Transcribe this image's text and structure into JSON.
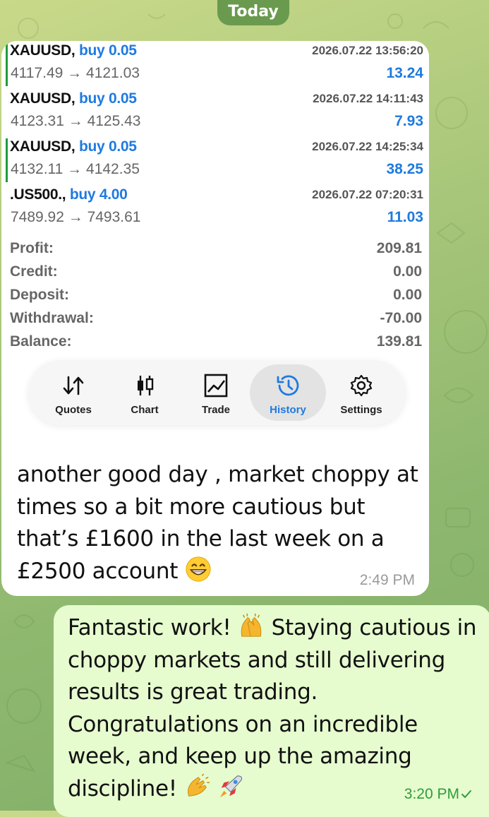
{
  "date_label": "Today",
  "trades": [
    {
      "symbol": "XAUUSD,",
      "side": "buy 0.05",
      "time": "2026.07.22 13:56:20",
      "prices": "4117.49 → 4121.03",
      "profit": "13.24"
    },
    {
      "symbol": "XAUUSD,",
      "side": "buy 0.05",
      "time": "2026.07.22 14:11:43",
      "prices": "4123.31 → 4125.43",
      "profit": "7.93"
    },
    {
      "symbol": "XAUUSD,",
      "side": "buy 0.05",
      "time": "2026.07.22 14:25:34",
      "prices": "4132.11 → 4142.35",
      "profit": "38.25"
    },
    {
      "symbol": ".US500.,",
      "side": "buy 4.00",
      "time": "2026.07.22 07:20:31",
      "prices": "7489.92 → 7493.61",
      "profit": "11.03"
    }
  ],
  "summary": [
    {
      "label": "Profit:",
      "value": "209.81"
    },
    {
      "label": "Credit:",
      "value": "0.00"
    },
    {
      "label": "Deposit:",
      "value": "0.00"
    },
    {
      "label": "Withdrawal:",
      "value": "-70.00"
    },
    {
      "label": "Balance:",
      "value": "139.81"
    }
  ],
  "tabs": [
    {
      "label": "Quotes",
      "icon": "quotes-arrows-icon"
    },
    {
      "label": "Chart",
      "icon": "candlestick-icon"
    },
    {
      "label": "Trade",
      "icon": "trade-chart-icon"
    },
    {
      "label": "History",
      "icon": "history-clock-icon",
      "active": true
    },
    {
      "label": "Settings",
      "icon": "gear-icon"
    }
  ],
  "incoming": {
    "text": "another good day , market choppy at times so a bit more cautious but that’s £1600 in the last week on a £2500 account",
    "emoji": "grinning-face-emoji",
    "time": "2:49 PM"
  },
  "outgoing": {
    "text_a": "Fantastic work!",
    "text_b": "Staying cautious in choppy markets and still delivering results is great trading. Congratulations on an incredible week, and keep up the amazing discipline!",
    "emojis": [
      "raising-hands-emoji",
      "clapping-hands-emoji",
      "rocket-emoji"
    ],
    "time": "3:20 PM",
    "status": "delivered-check"
  },
  "colors": {
    "accent_blue": "#1f7ae0",
    "buy_bar_green": "#1f9d3a",
    "outgoing_bubble": "#e6fccf",
    "wallpaper": "#a9c77a"
  }
}
